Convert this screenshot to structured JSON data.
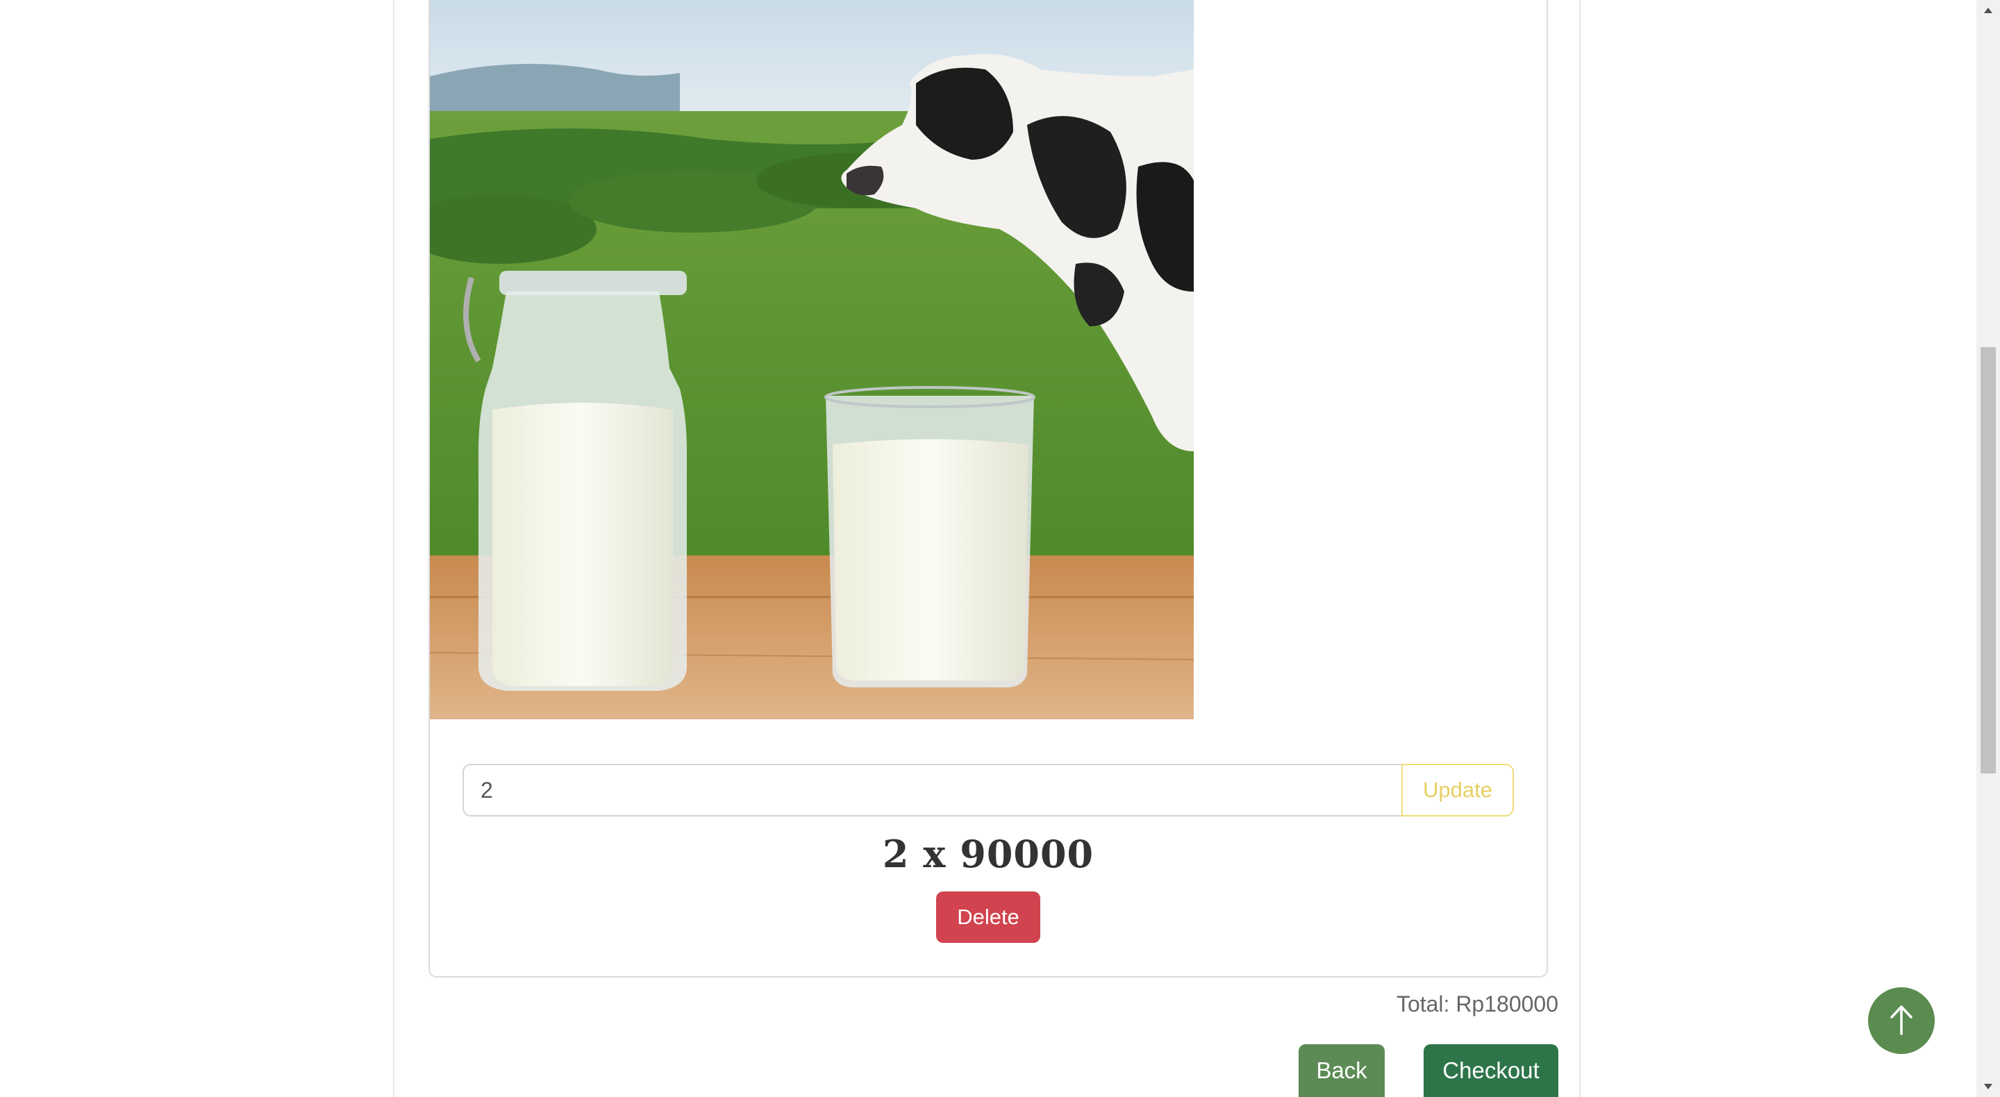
{
  "cart_item": {
    "image_alt": "Milk bottle and glass with cow",
    "quantity_value": "2",
    "update_label": "Update",
    "line_total": "2 x 90000",
    "delete_label": "Delete"
  },
  "summary": {
    "total_text": "Total: Rp180000"
  },
  "actions": {
    "back_label": "Back",
    "checkout_label": "Checkout"
  },
  "icons": {
    "scroll_top": "arrow-up-icon",
    "scroll_up": "triangle-up-icon",
    "scroll_down": "triangle-down-icon"
  },
  "colors": {
    "delete": "#d1434f",
    "back": "#5d8b56",
    "checkout": "#2d7549",
    "update": "#e6cf63",
    "scroll_top": "#5a8b4f"
  }
}
